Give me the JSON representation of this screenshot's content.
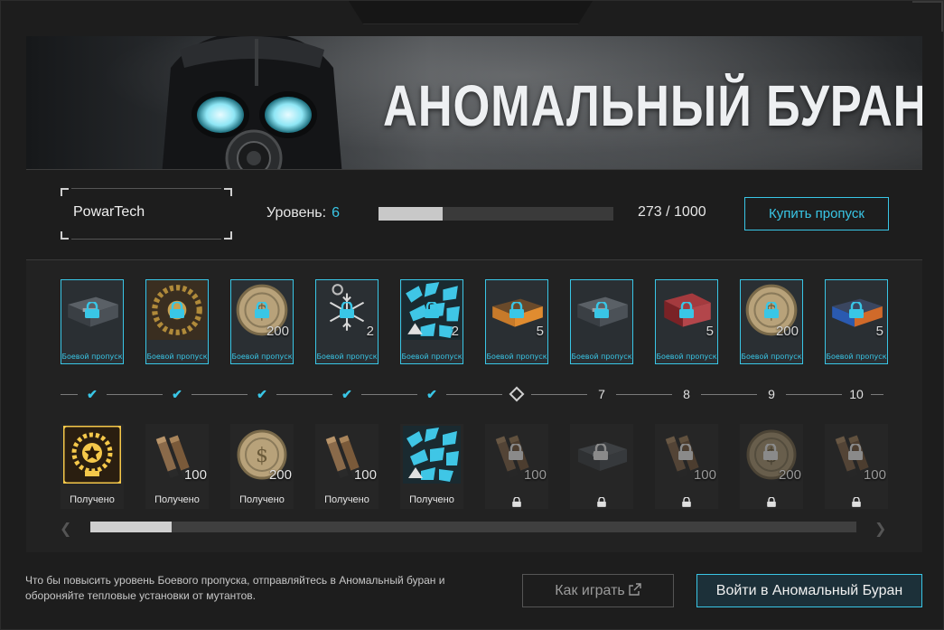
{
  "banner": {
    "title": "АНОМАЛЬНЫЙ БУРАН"
  },
  "player": {
    "name": "PowarTech",
    "level_label": "Уровень:",
    "level": "6",
    "xp_text": "273 / 1000",
    "xp_fraction": 0.273
  },
  "buy_button": {
    "label": "Купить пропуск"
  },
  "premium_rewards": [
    {
      "label": "Боевой пропуск",
      "count": "",
      "icon": "crate-icon"
    },
    {
      "label": "Боевой пропуск",
      "count": "",
      "icon": "laurel-emblem-icon"
    },
    {
      "label": "Боевой пропуск",
      "count": "200",
      "icon": "coin-icon"
    },
    {
      "label": "Боевой пропуск",
      "count": "2",
      "icon": "snowflake-icon"
    },
    {
      "label": "Боевой пропуск",
      "count": "2",
      "icon": "camo-skin-icon"
    },
    {
      "label": "Боевой пропуск",
      "count": "5",
      "icon": "orange-case-icon"
    },
    {
      "label": "Боевой пропуск",
      "count": "",
      "icon": "metal-crate-icon"
    },
    {
      "label": "Боевой пропуск",
      "count": "5",
      "icon": "red-case-icon"
    },
    {
      "label": "Боевой пропуск",
      "count": "200",
      "icon": "coin-icon"
    },
    {
      "label": "Боевой пропуск",
      "count": "5",
      "icon": "blue-case-icon"
    }
  ],
  "track": {
    "nodes": [
      {
        "type": "check"
      },
      {
        "type": "check"
      },
      {
        "type": "check"
      },
      {
        "type": "check"
      },
      {
        "type": "check"
      },
      {
        "type": "current"
      },
      {
        "type": "number",
        "text": "7"
      },
      {
        "type": "number",
        "text": "8"
      },
      {
        "type": "number",
        "text": "9"
      },
      {
        "type": "number",
        "text": "10"
      }
    ]
  },
  "free_rewards": [
    {
      "label": "Получено",
      "count": "",
      "locked": false,
      "icon": "gold-laurel-badge-icon"
    },
    {
      "label": "Получено",
      "count": "100",
      "locked": false,
      "icon": "ammo-icon"
    },
    {
      "label": "Получено",
      "count": "200",
      "locked": false,
      "icon": "coin-icon"
    },
    {
      "label": "Получено",
      "count": "100",
      "locked": false,
      "icon": "ammo-icon"
    },
    {
      "label": "Получено",
      "count": "",
      "locked": false,
      "icon": "camo-skin-icon"
    },
    {
      "label": "",
      "count": "100",
      "locked": true,
      "icon": "ammo-icon"
    },
    {
      "label": "",
      "count": "",
      "locked": true,
      "icon": "metal-crate-icon"
    },
    {
      "label": "",
      "count": "100",
      "locked": true,
      "icon": "ammo-icon"
    },
    {
      "label": "",
      "count": "200",
      "locked": true,
      "icon": "coin-icon"
    },
    {
      "label": "",
      "count": "100",
      "locked": true,
      "icon": "ammo-icon"
    }
  ],
  "scroll": {
    "position_fraction": 0.0,
    "thumb_fraction": 0.106
  },
  "footer": {
    "text": "Что бы повысить уровень Боевого пропуска, отправляйтесь в Аномальный буран и обороняйте тепловые установки от мутантов.",
    "how_to_play": "Как играть",
    "enter": "Войти в Аномальный Буран"
  },
  "colors": {
    "accent": "#39c6e6",
    "background": "#1d1d1d",
    "panel": "#222222"
  }
}
